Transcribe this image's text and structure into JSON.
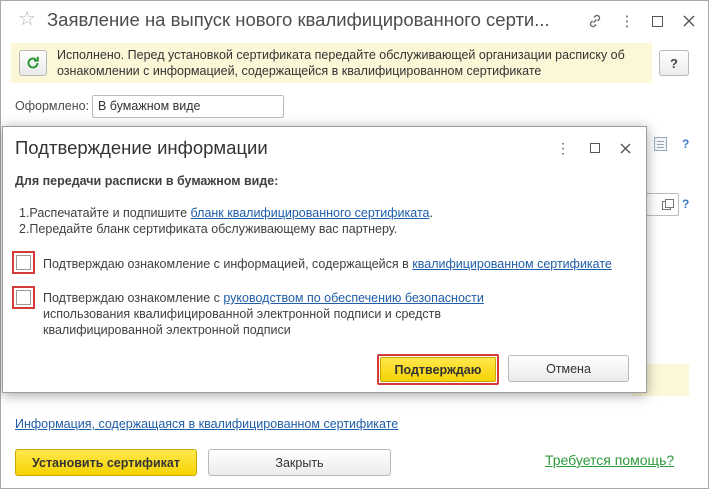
{
  "window": {
    "title": "Заявление на выпуск нового квалифицированного серти...",
    "notice": "Исполнено. Перед установкой сертификата передайте обслуживающей организации расписку об ознакомлении с информацией, содержащейся в квалифицированном сертификате",
    "help_label": "?",
    "form_label": "Оформлено:",
    "form_value": "В бумажном виде",
    "info_link": "Информация, содержащаяся в квалифицированном сертификате",
    "install_button": "Установить сертификат",
    "close_button": "Закрыть",
    "help_link": "Требуется помощь?",
    "side_help": "?"
  },
  "dialog": {
    "title": "Подтверждение информации",
    "subtitle": "Для передачи расписки в бумажном виде:",
    "step1_prefix": "1.Распечатайте и подпишите ",
    "step1_link": "бланк квалифицированного сертификата",
    "step1_suffix": ".",
    "step2": "2.Передайте бланк сертификата обслуживающему вас партнеру.",
    "check1_prefix": "Подтверждаю ознакомление с информацией, содержащейся в ",
    "check1_link": "квалифицированном сертификате",
    "check2_prefix": "Подтверждаю ознакомление с ",
    "check2_link": "руководством по обеспечению безопасности",
    "check2_line2": "использования квалифицированной электронной подписи и средств",
    "check2_line3": "квалифицированной электронной подписи",
    "confirm_button": "Подтверждаю",
    "cancel_button": "Отмена"
  },
  "colors": {
    "accent_yellow": "#f5d300",
    "notice_bg": "#fbf7d7",
    "link": "#1f5ea8",
    "help_link": "#2e9a3a",
    "highlight": "#d63b3b"
  }
}
